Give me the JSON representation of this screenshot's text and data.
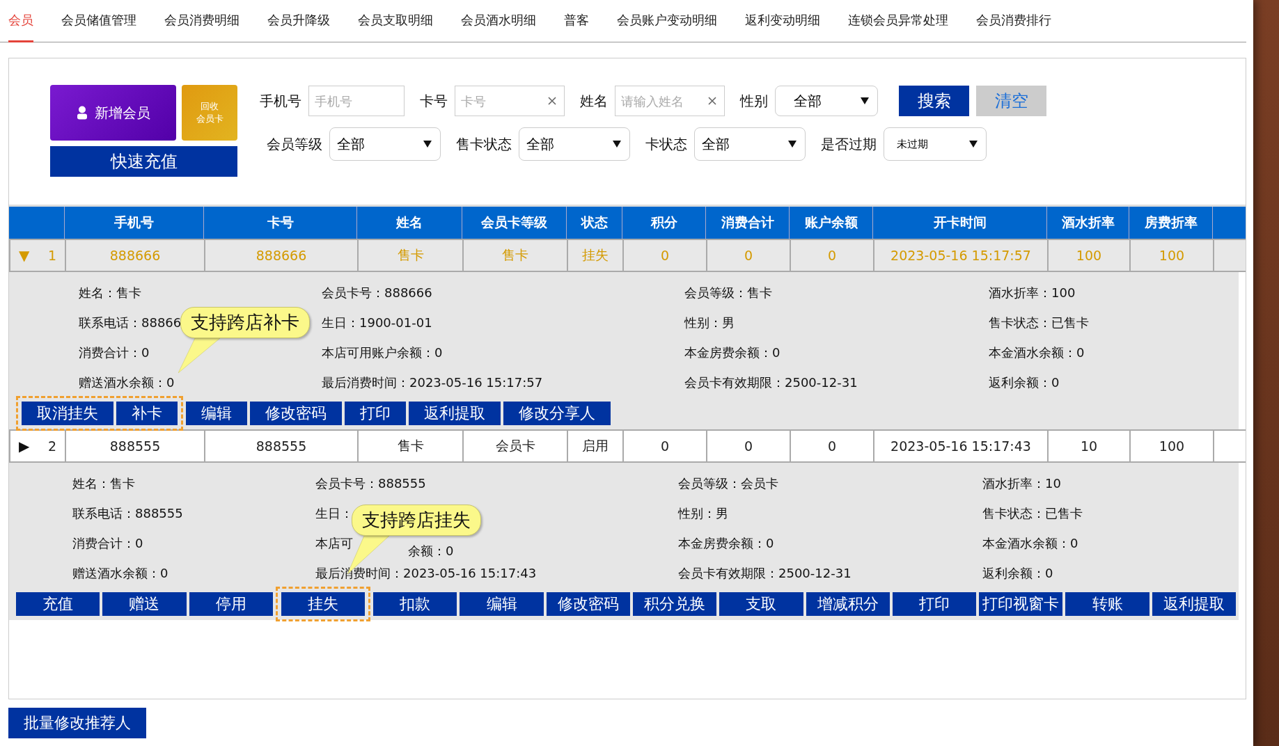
{
  "tabs": [
    {
      "label": "会员",
      "selected": true
    },
    {
      "label": "会员储值管理",
      "selected": false
    },
    {
      "label": "会员消费明细",
      "selected": false
    },
    {
      "label": "会员升降级",
      "selected": false
    },
    {
      "label": "会员支取明细",
      "selected": false
    },
    {
      "label": "会员酒水明细",
      "selected": false
    },
    {
      "label": "普客",
      "selected": false
    },
    {
      "label": "会员账户变动明细",
      "selected": false
    },
    {
      "label": "返利变动明细",
      "selected": false
    },
    {
      "label": "连锁会员异常处理",
      "selected": false
    },
    {
      "label": "会员消费排行",
      "selected": false
    }
  ],
  "actions": {
    "add_member": "新增会员",
    "recycle_card": [
      "回收",
      "会员卡"
    ],
    "quick_recharge": "快速充值"
  },
  "filters_row1": [
    {
      "kind": "input",
      "label": "手机号",
      "placeholder": "手机号",
      "clearable": false
    },
    {
      "kind": "input",
      "label": "卡号",
      "placeholder": "卡号",
      "clearable": true
    },
    {
      "kind": "input",
      "label": "姓名",
      "placeholder": "请输入姓名",
      "clearable": true
    },
    {
      "kind": "select",
      "label": "性别",
      "value": "全部"
    }
  ],
  "search_button": "搜索",
  "clear_button": "清空",
  "filters_row2": [
    {
      "kind": "select",
      "label": "会员等级",
      "value": "全部",
      "small": false
    },
    {
      "kind": "select",
      "label": "售卡状态",
      "value": "全部",
      "small": false
    },
    {
      "kind": "select",
      "label": "卡状态",
      "value": "全部",
      "small": false
    },
    {
      "kind": "select",
      "label": "是否过期",
      "value": "未过期",
      "small": true
    }
  ],
  "table": {
    "columns": [
      "手机号",
      "卡号",
      "姓名",
      "会员卡等级",
      "状态",
      "积分",
      "消费合计",
      "账户余额",
      "开卡时间",
      "酒水折率",
      "房费折率"
    ],
    "rows": [
      {
        "toggle": "▼",
        "index": "1",
        "selected": true,
        "cells": [
          "888666",
          "888666",
          "售卡",
          "售卡",
          "挂失",
          "0",
          "0",
          "0",
          "2023-05-16 15:17:57",
          "100",
          "100"
        ],
        "details": [
          [
            "姓名：售卡",
            "联系电话：88866",
            "消费合计：0",
            "赠送酒水余额：0"
          ],
          [
            "会员卡号：888666",
            "生日：1900-01-01",
            "本店可用账户余额：0",
            "最后消费时间：2023-05-16 15:17:57"
          ],
          [
            "会员等级：售卡",
            "性别：男",
            "本金房费余额：0",
            "会员卡有效期限：2500-12-31"
          ],
          [
            "酒水折率：100",
            "售卡状态：已售卡",
            "本金酒水余额：0",
            "返利余额：0"
          ]
        ],
        "buttons": [
          {
            "label": "取消挂失",
            "highlighted": true
          },
          {
            "label": "补卡",
            "highlighted": true
          },
          {
            "label": "编辑",
            "highlighted": false
          },
          {
            "label": "修改密码",
            "highlighted": false
          },
          {
            "label": "打印",
            "highlighted": false
          },
          {
            "label": "返利提取",
            "highlighted": false
          },
          {
            "label": "修改分享人",
            "highlighted": false
          }
        ],
        "callout": {
          "text": "支持跨店补卡"
        }
      },
      {
        "toggle": "▶",
        "index": "2",
        "selected": false,
        "cells": [
          "888555",
          "888555",
          "售卡",
          "会员卡",
          "启用",
          "0",
          "0",
          "0",
          "2023-05-16 15:17:43",
          "10",
          "100"
        ],
        "details": [
          [
            "姓名：售卡",
            "联系电话：888555",
            "消费合计：0",
            "赠送酒水余额：0"
          ],
          [
            "会员卡号：888555",
            "生日：",
            "本店可",
            "最后消费时间：2023-05-16 15:17:43"
          ],
          [
            "会员等级：会员卡",
            "性别：男",
            "本金房费余额：0",
            "会员卡有效期限：2500-12-31"
          ],
          [
            "酒水折率：10",
            "售卡状态：已售卡",
            "本金酒水余额：0",
            "返利余额：0"
          ]
        ],
        "buttons": [
          {
            "label": "充值",
            "highlighted": false
          },
          {
            "label": "赠送",
            "highlighted": false
          },
          {
            "label": "停用",
            "highlighted": false
          },
          {
            "label": "挂失",
            "highlighted": true
          },
          {
            "label": "扣款",
            "highlighted": false
          },
          {
            "label": "编辑",
            "highlighted": false
          },
          {
            "label": "修改密码",
            "highlighted": false
          },
          {
            "label": "积分兑换",
            "highlighted": false
          },
          {
            "label": "支取",
            "highlighted": false
          },
          {
            "label": "增减积分",
            "highlighted": false
          },
          {
            "label": "打印",
            "highlighted": false
          },
          {
            "label": "打印视窗卡",
            "highlighted": false
          },
          {
            "label": "转账",
            "highlighted": false
          },
          {
            "label": "返利提取",
            "highlighted": false
          }
        ],
        "callout": {
          "text": "支持跨店挂失"
        },
        "covered_tail": "余额：0"
      }
    ]
  },
  "bottom_button": "批量修改推荐人"
}
